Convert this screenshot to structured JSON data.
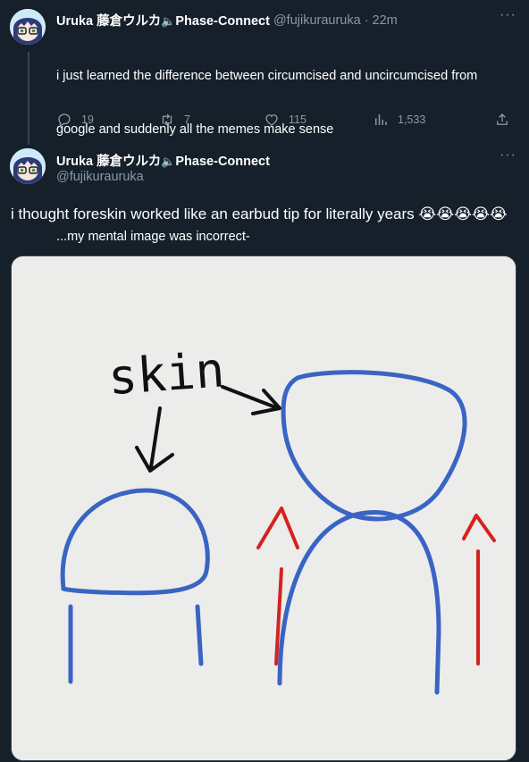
{
  "reply_tweet": {
    "display_name": "Uruka 藤倉ウルカ",
    "speaker": "🔈",
    "org": "Phase-Connect",
    "handle": "@fujikurauruka",
    "separator": "·",
    "time": "22m",
    "text_line1": "i just learned the difference between circumcised and uncircumcised from",
    "text_line2": "google and suddenly all the memes make sense",
    "text_line3": "...my mental image was incorrect-",
    "replies": "19",
    "retweets": "7",
    "likes": "115",
    "views": "1,533"
  },
  "main_tweet": {
    "display_name": "Uruka 藤倉ウルカ",
    "speaker": "🔈",
    "org": "Phase-Connect",
    "handle": "@fujikurauruka",
    "text": "i thought foreskin worked like an earbud tip for literally years",
    "emojis": "😭😭😭😭😭",
    "image_label": "skin"
  },
  "icons": {
    "more": "more-icon",
    "reply": "reply-icon",
    "retweet": "retweet-icon",
    "like": "heart-icon",
    "views": "views-icon",
    "share": "share-icon"
  },
  "colors": {
    "background": "#15202b",
    "secondary_text": "#8b98a5",
    "drawing_blue": "#3a64c4",
    "drawing_red": "#d4231f"
  }
}
